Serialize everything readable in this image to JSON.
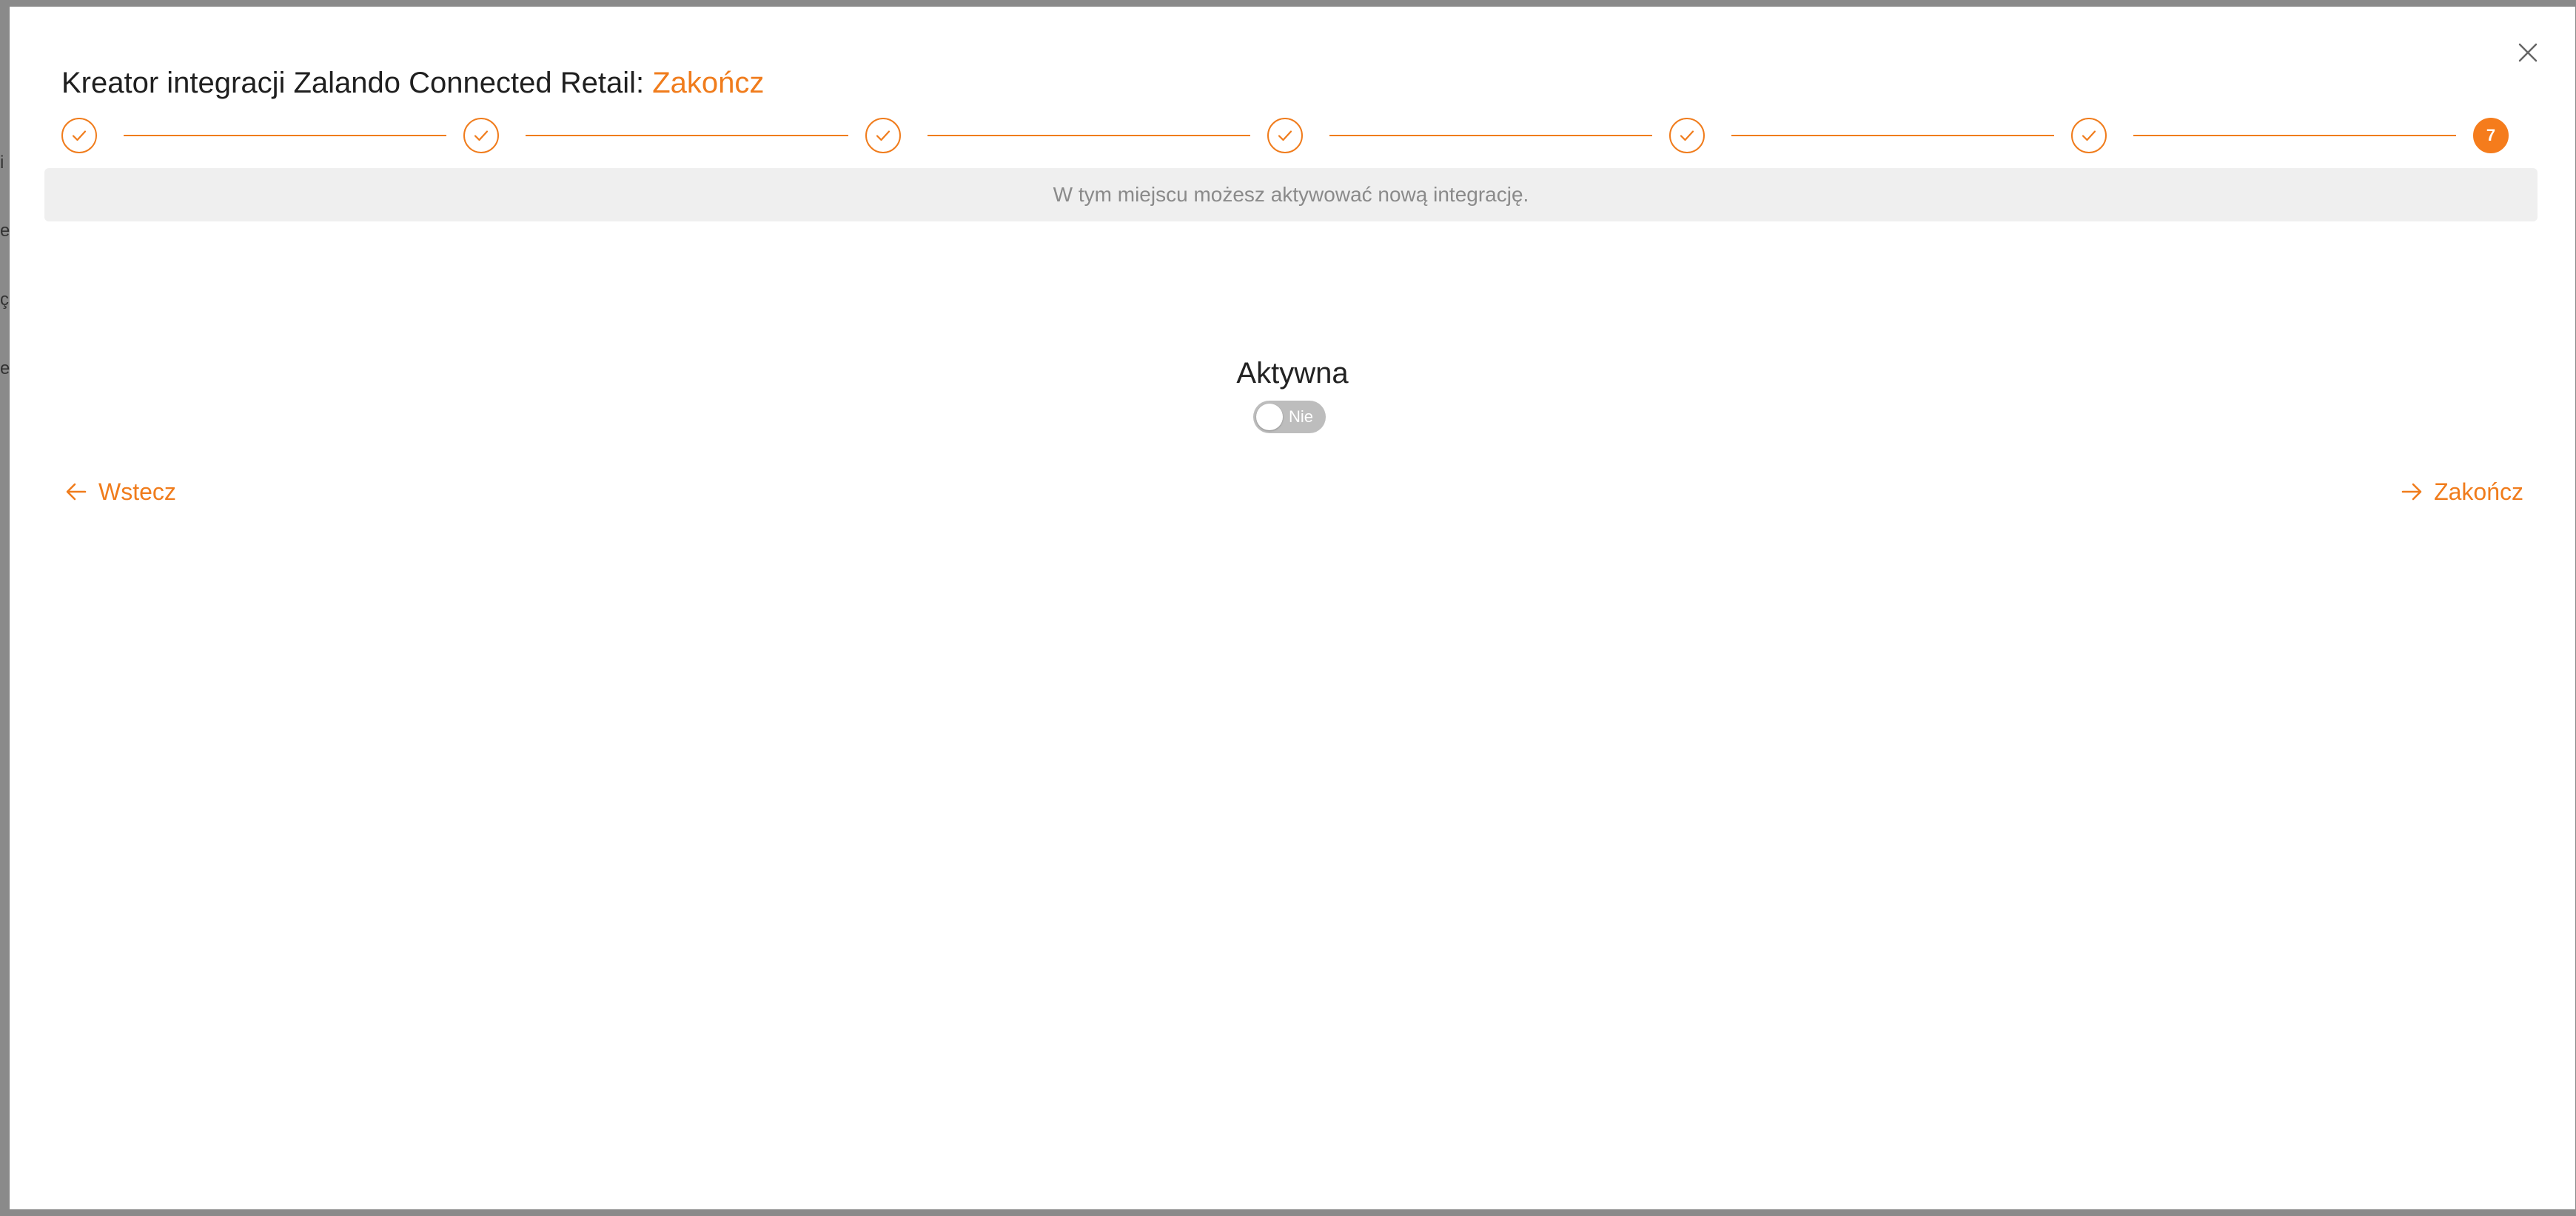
{
  "backdrop": {
    "fragments": [
      "i",
      "e",
      "ç",
      "er"
    ]
  },
  "modal": {
    "title_prefix": "Kreator integracji Zalando Connected Retail:",
    "title_step": "Zakończ",
    "close_icon": "close-icon",
    "stepper": {
      "completed_icon": "checkmark-icon",
      "current_step_number": "7",
      "total_steps": 7,
      "current_step": 7
    },
    "info_text": "W tym miejscu możesz aktywować nową integrację.",
    "active_field": {
      "label": "Aktywna",
      "toggle_state": "Nie"
    },
    "buttons": {
      "back_label": "Wstecz",
      "finish_label": "Zakończ"
    }
  },
  "colors": {
    "accent": "#f07c1c",
    "info_bar_bg": "#efefef",
    "toggle_off": "#bdbdbd",
    "backdrop": "#8a8a8a"
  }
}
